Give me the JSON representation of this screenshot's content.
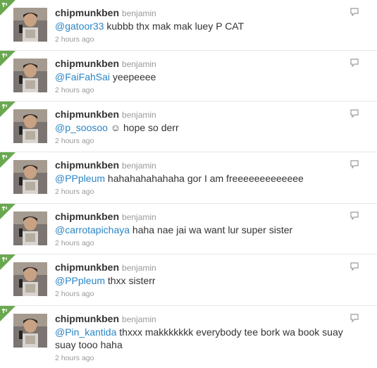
{
  "timeline": {
    "tweets": [
      {
        "screen_name": "chipmunkben",
        "full_name": "benjamin",
        "mention": "@gatoor33",
        "text": " kubbb thx mak mak luey P CAT",
        "timestamp": "2 hours ago",
        "icons": [
          "favorite-corner-icon",
          "avatar",
          "reply-icon"
        ]
      },
      {
        "screen_name": "chipmunkben",
        "full_name": "benjamin",
        "mention": "@FaiFahSai",
        "text": " yeepeeee",
        "timestamp": "2 hours ago",
        "icons": [
          "favorite-corner-icon",
          "avatar",
          "reply-icon"
        ]
      },
      {
        "screen_name": "chipmunkben",
        "full_name": "benjamin",
        "mention": "@p_soosoo",
        "text": " ☺ hope so derr",
        "timestamp": "2 hours ago",
        "icons": [
          "favorite-corner-icon",
          "avatar",
          "reply-icon"
        ]
      },
      {
        "screen_name": "chipmunkben",
        "full_name": "benjamin",
        "mention": "@PPpleum",
        "text": " hahahahahahaha gor I am freeeeeeeeeeeee",
        "timestamp": "2 hours ago",
        "icons": [
          "favorite-corner-icon",
          "avatar",
          "reply-icon"
        ]
      },
      {
        "screen_name": "chipmunkben",
        "full_name": "benjamin",
        "mention": "@carrotapichaya",
        "text": " haha nae jai wa want lur super sister",
        "timestamp": "2 hours ago",
        "icons": [
          "favorite-corner-icon",
          "avatar",
          "reply-icon"
        ]
      },
      {
        "screen_name": "chipmunkben",
        "full_name": "benjamin",
        "mention": "@PPpleum",
        "text": " thxx sisterr",
        "timestamp": "2 hours ago",
        "icons": [
          "favorite-corner-icon",
          "avatar",
          "reply-icon"
        ]
      },
      {
        "screen_name": "chipmunkben",
        "full_name": "benjamin",
        "mention": "@Pin_kantida",
        "text": " thxxx makkkkkkk everybody tee bork wa book suay suay tooo haha",
        "timestamp": "2 hours ago",
        "icons": [
          "favorite-corner-icon",
          "avatar",
          "reply-icon"
        ]
      }
    ]
  },
  "colors": {
    "mention": "#2a85c5",
    "screen_name": "#333333",
    "meta": "#999999",
    "corner_green": "#6aa84f",
    "divider": "#e6e6e6"
  }
}
